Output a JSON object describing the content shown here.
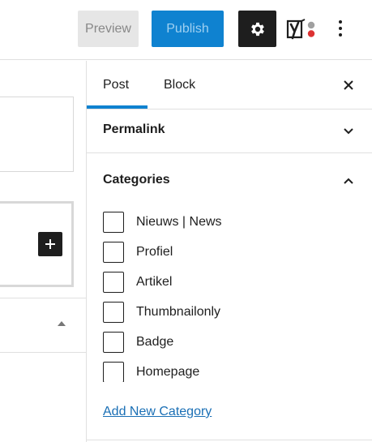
{
  "toolbar": {
    "preview_label": "Preview",
    "publish_label": "Publish",
    "settings_icon": "gear-icon",
    "yoast_icon": "yoast-icon",
    "more_icon": "more-vertical-icon",
    "accent_color": "#0f82d0"
  },
  "sidebar": {
    "tabs": [
      {
        "label": "Post",
        "active": true
      },
      {
        "label": "Block",
        "active": false
      }
    ],
    "close_icon": "close-icon",
    "permalink": {
      "title": "Permalink",
      "expanded": false
    },
    "categories": {
      "title": "Categories",
      "expanded": true,
      "items": [
        {
          "label": "Nieuws | News",
          "checked": false
        },
        {
          "label": "Profiel",
          "checked": false
        },
        {
          "label": "Artikel",
          "checked": false
        },
        {
          "label": "Thumbnailonly",
          "checked": false
        },
        {
          "label": "Badge",
          "checked": false
        },
        {
          "label": "Homepage",
          "checked": false
        },
        {
          "label": "",
          "checked": false
        }
      ],
      "add_new_label": "Add New Category"
    }
  },
  "editor": {
    "add_block_icon": "plus-icon",
    "collapse_icon": "caret-up-icon"
  }
}
